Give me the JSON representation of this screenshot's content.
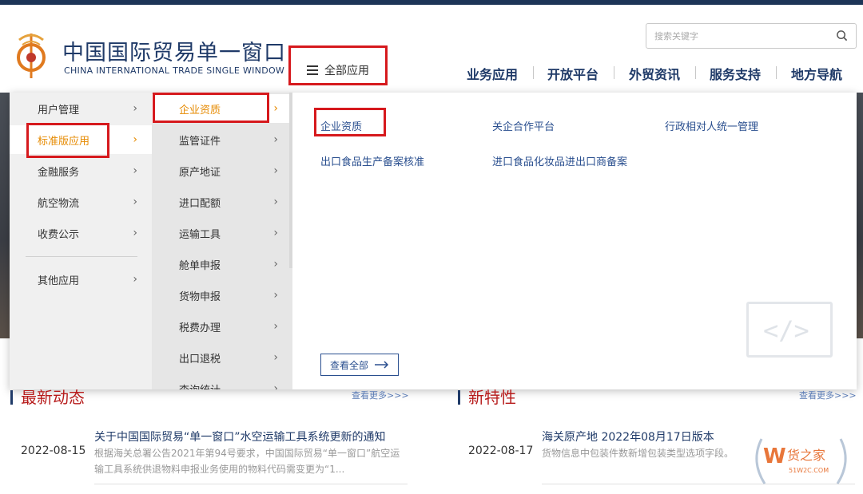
{
  "logo": {
    "cn": "中国国际贸易单一窗口",
    "en": "CHINA INTERNATIONAL TRADE SINGLE WINDOW"
  },
  "all_apps": {
    "label": "全部应用"
  },
  "search": {
    "placeholder": "搜索关键字"
  },
  "nav": [
    {
      "label": "业务应用"
    },
    {
      "label": "开放平台"
    },
    {
      "label": "外贸资讯"
    },
    {
      "label": "服务支持"
    },
    {
      "label": "地方导航"
    }
  ],
  "menu": {
    "col1": [
      {
        "label": "用户管理",
        "active": false
      },
      {
        "label": "标准版应用",
        "active": true
      },
      {
        "label": "金融服务",
        "active": false
      },
      {
        "label": "航空物流",
        "active": false
      },
      {
        "label": "收费公示",
        "active": false
      },
      {
        "label": "其他应用",
        "active": false
      }
    ],
    "col2": [
      {
        "label": "企业资质",
        "active": true
      },
      {
        "label": "监管证件",
        "active": false
      },
      {
        "label": "原产地证",
        "active": false
      },
      {
        "label": "进口配额",
        "active": false
      },
      {
        "label": "运输工具",
        "active": false
      },
      {
        "label": "舱单申报",
        "active": false
      },
      {
        "label": "货物申报",
        "active": false
      },
      {
        "label": "税费办理",
        "active": false
      },
      {
        "label": "出口退税",
        "active": false
      },
      {
        "label": "查询统计",
        "active": false
      }
    ],
    "col3": [
      {
        "label": "企业资质"
      },
      {
        "label": "关企合作平台"
      },
      {
        "label": "行政相对人统一管理"
      },
      {
        "label": "出口食品生产备案核准"
      },
      {
        "label": "进口食品化妆品进出口商备案"
      }
    ],
    "view_all": "查看全部",
    "arrow": "›"
  },
  "news_left": {
    "title": "最新动态",
    "more": "查看更多>>>",
    "date": "2022-08-15",
    "headline": "关于中国国际贸易“单一窗口”水空运输工具系统更新的通知",
    "desc": "根据海关总署公告2021年第94号要求，中国国际贸易“单一窗口”航空运输工具系统供退物料申报业务使用的物料代码需变更为“1..."
  },
  "news_right": {
    "title": "新特性",
    "more": "查看更多>>>",
    "date": "2022-08-17",
    "headline": "海关原产地 2022年08月17日版本",
    "desc": "货物信息中包装件数新增包装类型选项字段。"
  },
  "watermark": {
    "brand": "货之家",
    "domain": "51W2C.COM"
  },
  "colors": {
    "accent_red": "#d6191d",
    "brand_blue": "#1f3a68",
    "active_orange": "#e68a00"
  }
}
